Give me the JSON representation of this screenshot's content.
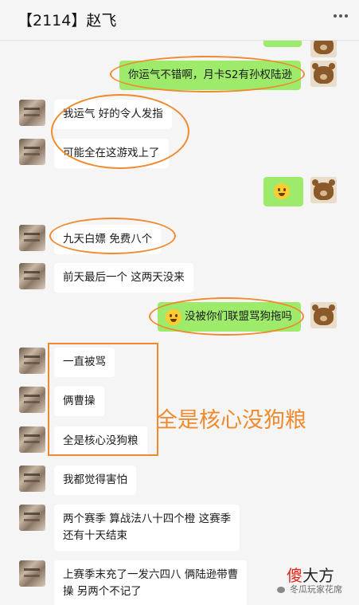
{
  "header": {
    "title": "【2114】赵飞",
    "more_icon": "more-dots-icon"
  },
  "messages": [
    {
      "side": "out",
      "text": ""
    },
    {
      "side": "out",
      "text": "你运气不错啊，月卡S2有孙权陆逊"
    },
    {
      "side": "in",
      "text": "我运气 好的令人发指"
    },
    {
      "side": "in",
      "text": "可能全在这游戏上了"
    },
    {
      "side": "out",
      "emoji": "laugh-cry-emoji"
    },
    {
      "side": "in",
      "text": "九天白嫖 免费八个"
    },
    {
      "side": "in",
      "text": "前天最后一个 这两天没来"
    },
    {
      "side": "out",
      "emoji": "shocked-emoji",
      "text": "没被你们联盟骂狗拖吗"
    },
    {
      "side": "in",
      "text": "一直被骂"
    },
    {
      "side": "in",
      "text": "俩曹操"
    },
    {
      "side": "in",
      "text": "全是核心没狗粮"
    },
    {
      "side": "in",
      "text": "我都觉得害怕"
    },
    {
      "side": "in",
      "line1": "两个赛季 算战法八十四个橙 这赛季",
      "line2": "还有十天结束"
    },
    {
      "side": "in",
      "line1": "上赛季末充了一发六四八 俩陆逊带曹",
      "line2": "操 另两个不记了"
    }
  ],
  "annotation": {
    "text": "全是核心没狗粮",
    "color": "#f08a2e"
  },
  "brand": {
    "red": "傻",
    "black": "大方"
  },
  "watermark": {
    "text": "冬瓜玩家花席"
  },
  "colors": {
    "outgoing": "#9eea6a",
    "incoming": "#ffffff",
    "background": "#f5f5f5",
    "highlight": "#f08a2e"
  }
}
